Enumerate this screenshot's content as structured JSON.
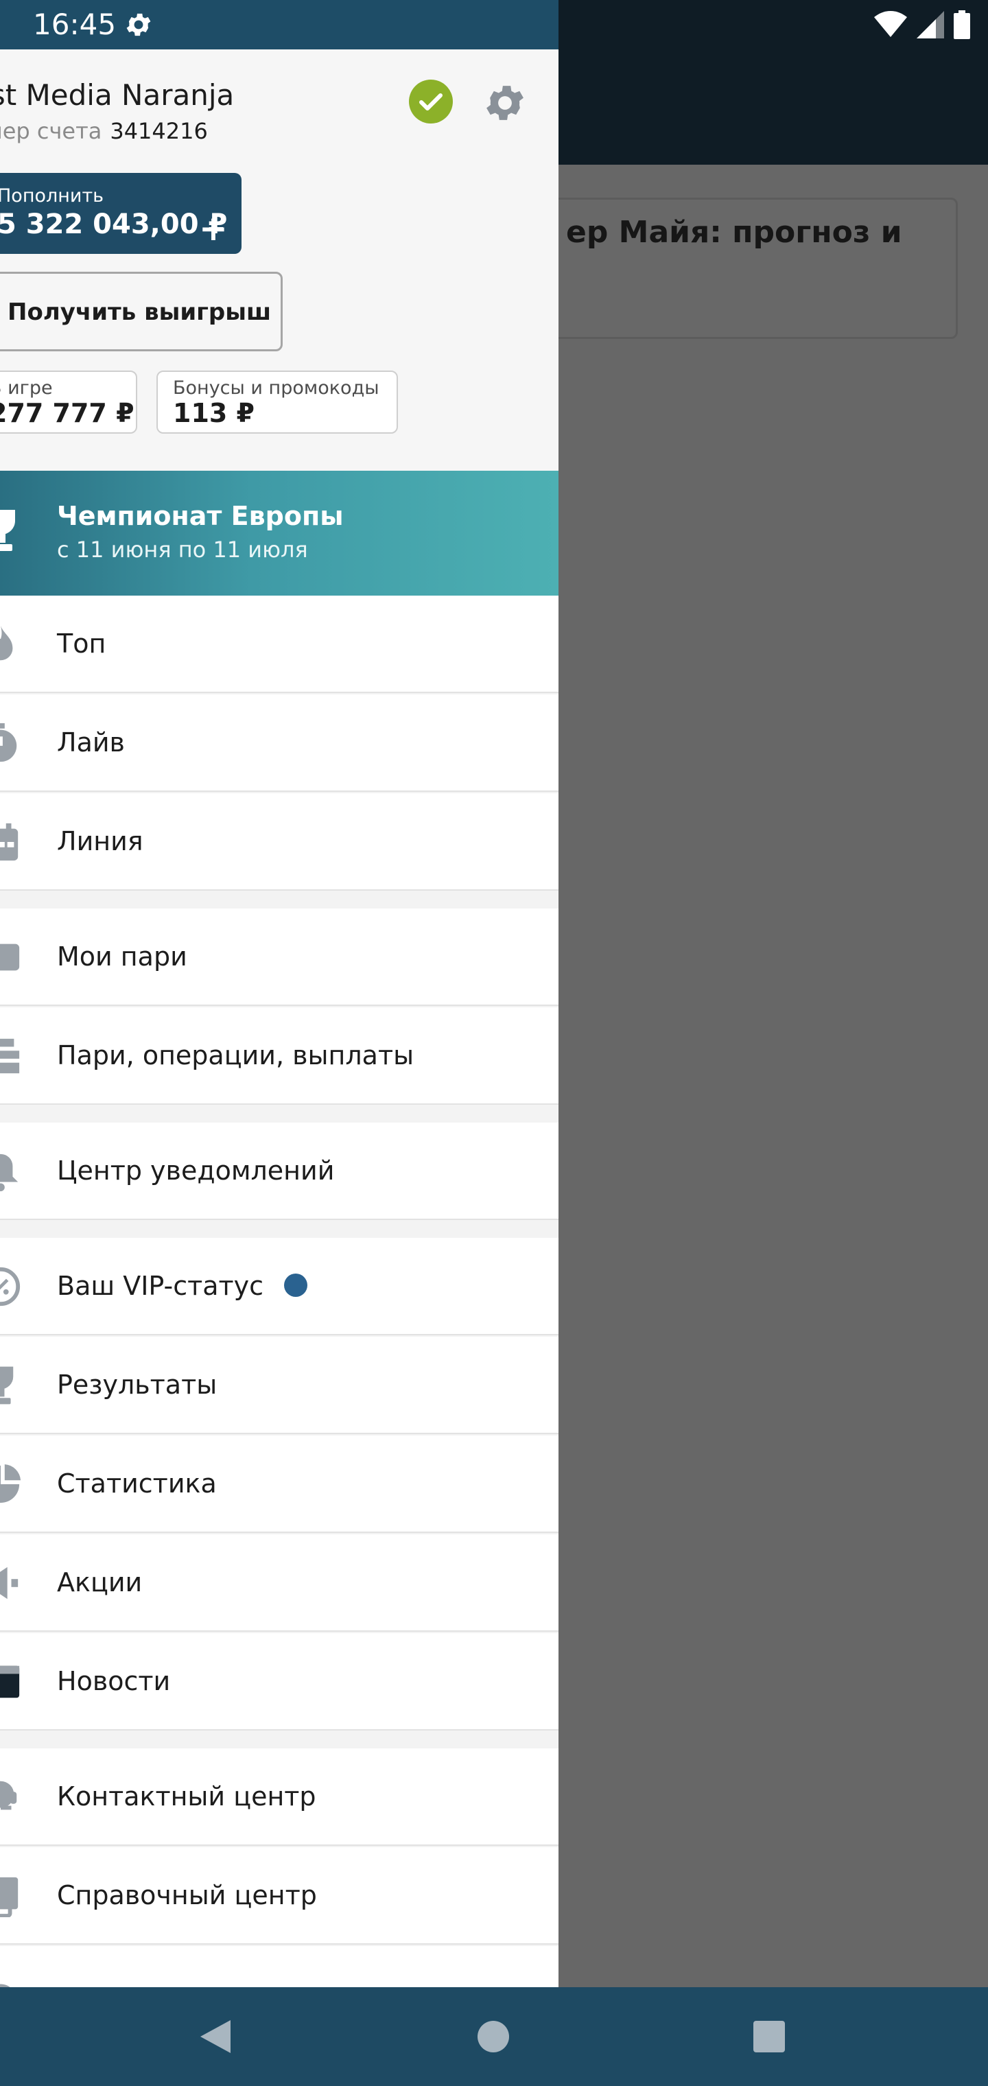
{
  "status_bar": {
    "time": "16:45",
    "icons": [
      "settings-icon",
      "wifi-icon",
      "signal-icon",
      "battery-icon"
    ]
  },
  "background_app": {
    "card_title": "ер Майя: прогноз и"
  },
  "account": {
    "name": "est Media Naranja",
    "number_label": "омер счета",
    "number": "3414216",
    "deposit_label": "Пополнить",
    "deposit_amount": "5 322 043,00 ₽",
    "deposit_plus": "+",
    "withdraw_label": "Получить выигрыш",
    "in_game_label": "В игре",
    "in_game_value": "277 777 ₽",
    "bonus_label": "Бонусы и промокоды",
    "bonus_value": "113 ₽"
  },
  "promo": {
    "title": "Чемпионат Европы",
    "subtitle": "с 11 июня по 11 июля"
  },
  "menu": [
    {
      "label": "Топ",
      "icon": "fire-icon"
    },
    {
      "label": "Лайв",
      "icon": "stopwatch-icon"
    },
    {
      "label": "Линия",
      "icon": "calendar-icon"
    },
    {
      "label": "Мои пари",
      "icon": "ticket-icon"
    },
    {
      "label": "Пари, операции, выплаты",
      "icon": "receipt-icon"
    },
    {
      "label": "Центр уведомлений",
      "icon": "bell-icon"
    },
    {
      "label": "Ваш VIP-статус",
      "icon": "percent-icon"
    },
    {
      "label": "Результаты",
      "icon": "trophy-icon"
    },
    {
      "label": "Статистика",
      "icon": "pie-chart-icon"
    },
    {
      "label": "Акции",
      "icon": "megaphone-icon"
    },
    {
      "label": "Новости",
      "icon": "newspaper-icon"
    },
    {
      "label": "Контактный центр",
      "icon": "support-icon"
    },
    {
      "label": "Справочный центр",
      "icon": "document-icon"
    },
    {
      "label": "",
      "icon": "partial-icon"
    }
  ],
  "colors": {
    "brand": "#1f4b66",
    "verified": "#8cb129",
    "vip_dot": "#2a6290",
    "promo_start": "#2a6f82",
    "promo_end": "#4db0b3"
  }
}
